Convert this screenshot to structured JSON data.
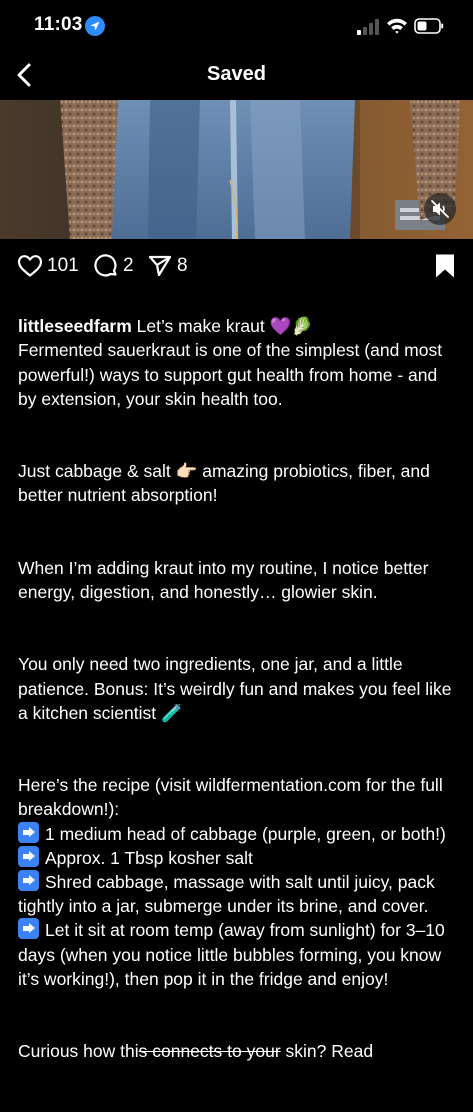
{
  "status_bar": {
    "time": "11:03",
    "icons": [
      "location-arrow-icon",
      "signal-icon",
      "wifi-icon",
      "battery-icon"
    ]
  },
  "nav": {
    "title": "Saved",
    "back_icon": "chevron-left-icon"
  },
  "media": {
    "mute_icon": "speaker-muted-icon"
  },
  "actions": {
    "likes": "101",
    "comments": "2",
    "shares": "8",
    "icons": [
      "heart-icon",
      "comment-icon",
      "send-icon",
      "bookmark-icon"
    ]
  },
  "caption": {
    "username": "littleseedfarm",
    "line1_text": " Let’s make kraut 💜🥬",
    "para1": "Fermented sauerkraut is one of the simplest (and most powerful!) ways to support gut health from home - and by extension, your skin health too.",
    "para2": "Just cabbage & salt 👉🏻 amazing probiotics, fiber, and better nutrient absorption!",
    "para3": "When I’m adding kraut into my routine, I notice better energy, digestion, and honestly… glowier skin.",
    "para4": "You only need two ingredients, one jar, and a little patience. Bonus: It’s weirdly fun and makes you feel like a kitchen scientist 🧪",
    "recipe_intro": "Here’s the recipe (visit wildfermentation.com for the full breakdown!):",
    "steps": [
      "1 medium head of cabbage (purple, green, or both!)",
      "Approx. 1 Tbsp kosher salt",
      "Shred cabbage, massage with salt until juicy, pack tightly into a jar, submerge under its brine, and cover.",
      "Let it sit at room temp (away from sunlight) for 3–10 days (when you notice little bubbles forming, you know it’s working!), then pop it in the fridge and enjoy!"
    ],
    "last_line_a": "Curious how thi",
    "last_line_strike": "s connects to your",
    "last_line_b": " skin? Read"
  },
  "colors": {
    "background": "#000000",
    "text": "#ffffff",
    "accent_blue": "#3b82f6"
  }
}
